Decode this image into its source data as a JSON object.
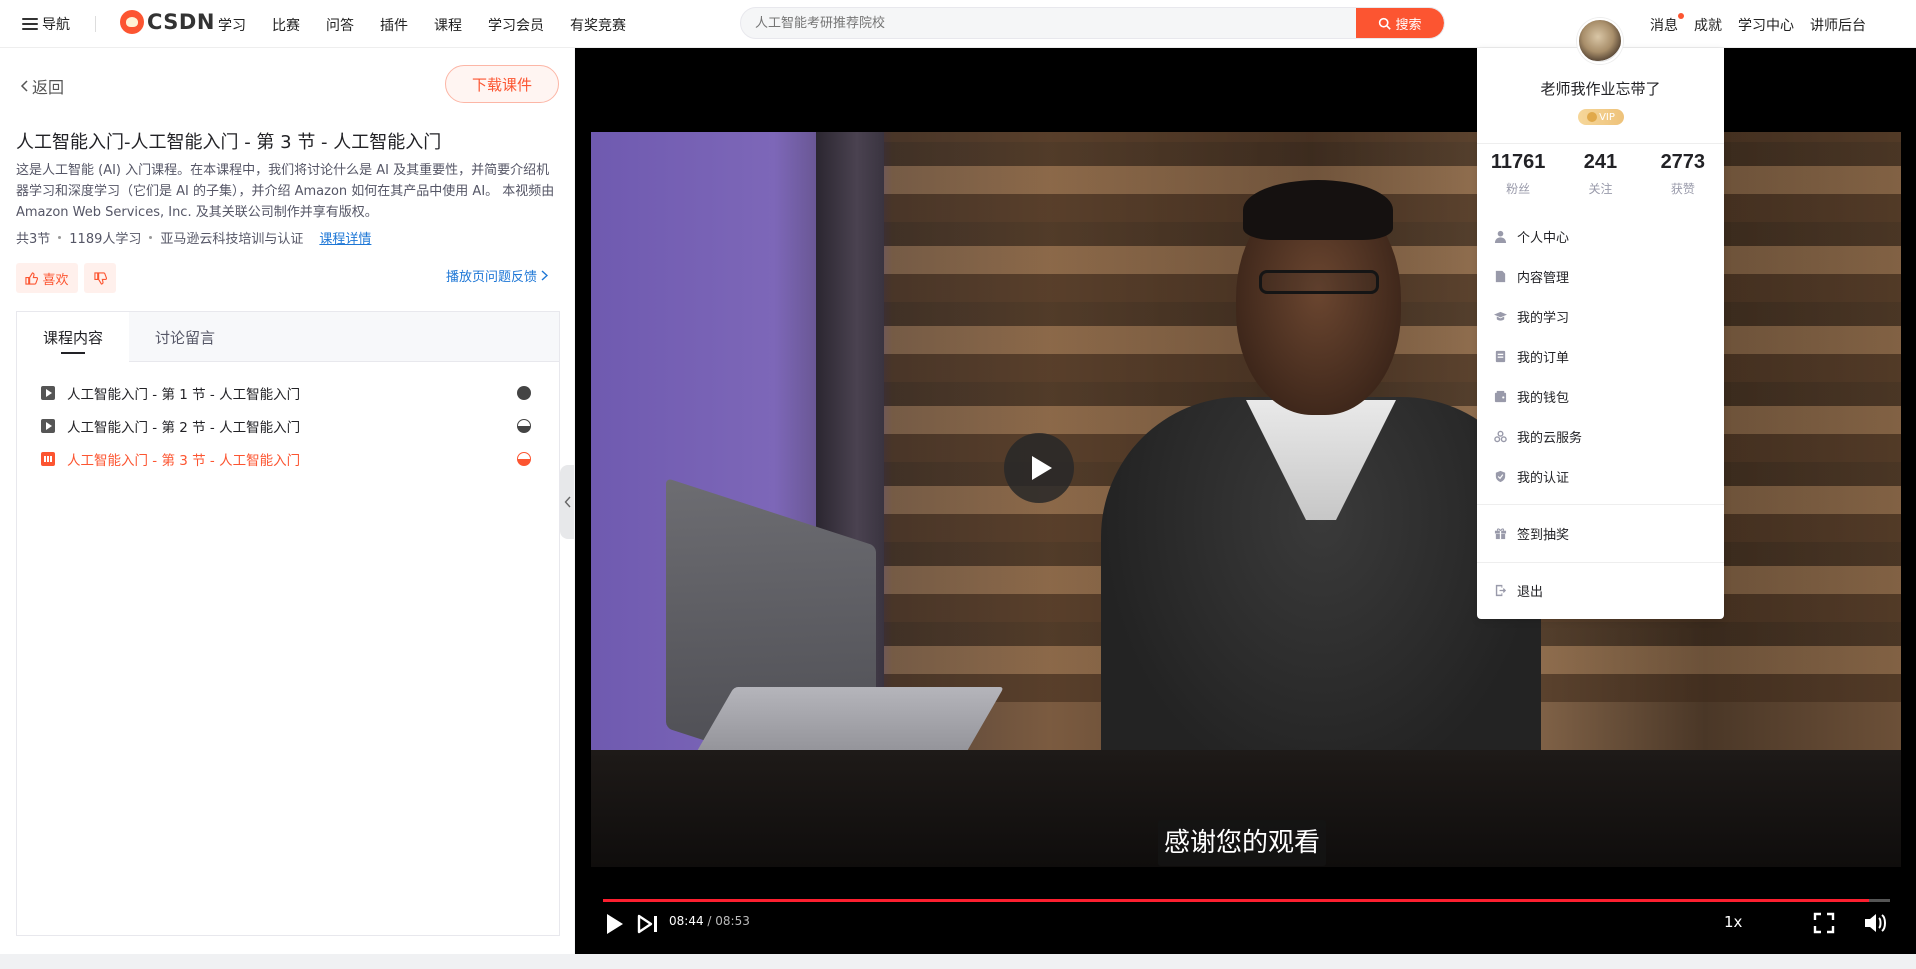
{
  "topbar": {
    "nav_label": "导航",
    "logo_text": "CSDN",
    "links": [
      "学习",
      "比赛",
      "问答",
      "插件",
      "课程",
      "学习会员",
      "有奖竞赛"
    ],
    "search_placeholder": "人工智能考研推荐院校",
    "search_button": "搜索",
    "right_links": [
      "消息",
      "成就",
      "学习中心",
      "讲师后台"
    ]
  },
  "left": {
    "back_label": "返回",
    "download_label": "下载课件",
    "title": "人工智能入门-人工智能入门 - 第 3 节 - 人工智能入门",
    "description": "这是人工智能 (AI) 入门课程。在本课程中，我们将讨论什么是 AI 及其重要性，并简要介绍机器学习和深度学习（它们是 AI 的子集），并介绍 Amazon 如何在其产品中使用 AI。 本视频由 Amazon Web Services, Inc. 及其关联公司制作并享有版权。",
    "meta_sections": "共3节",
    "meta_learners": "1189人学习",
    "meta_provider": "亚马逊云科技培训与认证",
    "detail_link": "课程详情",
    "like_label": "喜欢",
    "feedback_label": "播放页问题反馈",
    "tabs": [
      "课程内容",
      "讨论留言"
    ],
    "lessons": [
      {
        "title": "人工智能入门 - 第 1 节 - 人工智能入门",
        "status": "full"
      },
      {
        "title": "人工智能入门 - 第 2 节 - 人工智能入门",
        "status": "half"
      },
      {
        "title": "人工智能入门 - 第 3 节 - 人工智能入门",
        "status": "half-current"
      }
    ]
  },
  "player": {
    "subtitle": "感谢您的观看",
    "current_time": "08:44",
    "duration": "08:53",
    "progress_fraction": 0.984,
    "speed": "1x"
  },
  "dropdown": {
    "user_name": "老师我作业忘带了",
    "vip_label": "VIP",
    "stats": [
      {
        "value": "11761",
        "label": "粉丝"
      },
      {
        "value": "241",
        "label": "关注"
      },
      {
        "value": "2773",
        "label": "获赞"
      }
    ],
    "menu": [
      {
        "label": "个人中心",
        "icon": "user-icon"
      },
      {
        "label": "内容管理",
        "icon": "document-icon"
      },
      {
        "label": "我的学习",
        "icon": "graduation-cap-icon"
      },
      {
        "label": "我的订单",
        "icon": "order-icon"
      },
      {
        "label": "我的钱包",
        "icon": "wallet-icon"
      },
      {
        "label": "我的云服务",
        "icon": "cloud-service-icon"
      },
      {
        "label": "我的认证",
        "icon": "shield-check-icon"
      }
    ],
    "checkin_label": "签到抽奖",
    "logout_label": "退出"
  },
  "colors": {
    "brand": "#fc5531",
    "link": "#1e77d6",
    "progress": "#fc1f2f"
  }
}
